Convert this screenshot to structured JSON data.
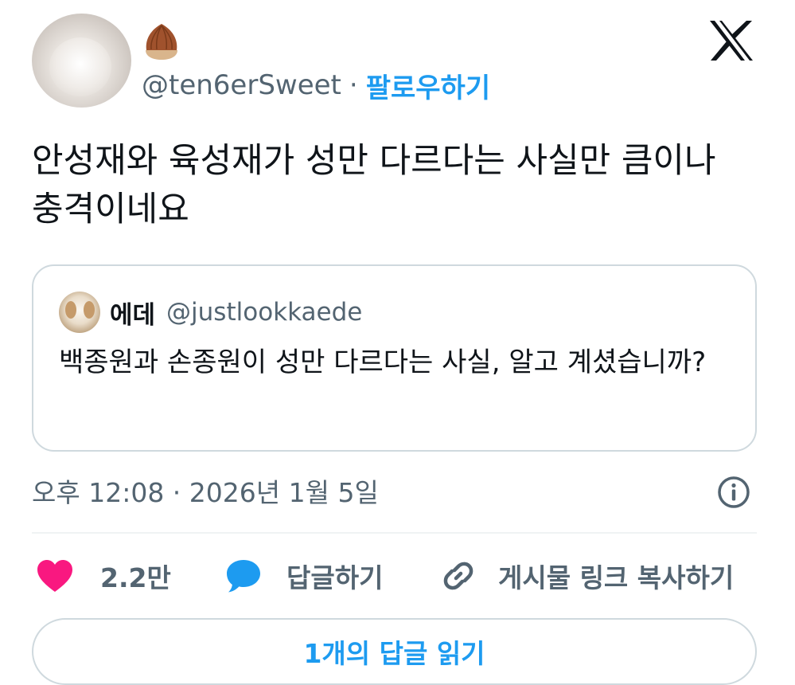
{
  "author": {
    "handle": "@ten6erSweet",
    "separator": "·",
    "follow_label": "팔로우하기",
    "avatar_icon": "hamster-avatar",
    "badge_icon": "chestnut-emoji"
  },
  "brand_icon": "x-logo",
  "tweet": {
    "text": "안성재와 육성재가 성만 다르다는 사실만 큼이나 충격이네요"
  },
  "quote": {
    "name": "에데",
    "handle": "@justlookkaede",
    "text": "백종원과 손종원이 성만 다르다는 사실,  알고 계셨습니까?",
    "avatar_icon": "puppy-avatar"
  },
  "meta": {
    "timestamp": "오후 12:08 · 2026년 1월 5일",
    "info_icon": "info-icon"
  },
  "actions": {
    "like_count": "2.2만",
    "reply_label": "답글하기",
    "copy_label": "게시물 링크 복사하기"
  },
  "replies_button": "1개의 답글 읽기",
  "colors": {
    "accent": "#1d9bf0",
    "like": "#f91880",
    "secondary_text": "#536471",
    "border": "#cfd9de"
  }
}
